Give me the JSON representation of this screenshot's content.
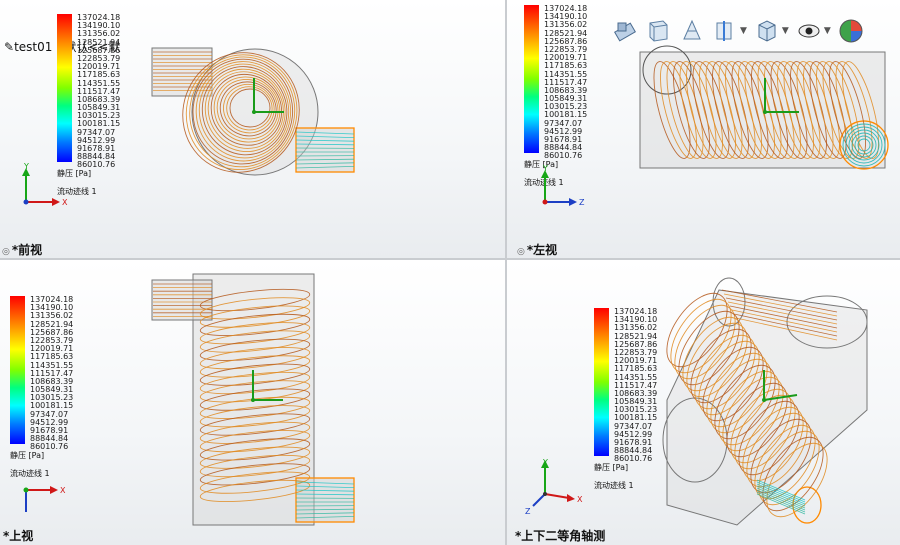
{
  "document": {
    "title": "test01（默认<<默"
  },
  "legend": {
    "values": [
      "137024.18",
      "134190.10",
      "131356.02",
      "128521.94",
      "125687.86",
      "122853.79",
      "120019.71",
      "117185.63",
      "114351.55",
      "111517.47",
      "108683.39",
      "105849.31",
      "103015.23",
      "100181.15",
      "97347.07",
      "94512.99",
      "91678.91",
      "88844.84",
      "86010.76"
    ],
    "unit": "静压 [Pa]",
    "trajectory_label": "流动迹线 1"
  },
  "viewports": {
    "front": {
      "label": "*前视"
    },
    "left": {
      "label": "*左视"
    },
    "top": {
      "label": "*上视"
    },
    "iso": {
      "label": "*上下二等角轴测"
    }
  },
  "axes": {
    "x": "X",
    "y": "Y",
    "z": "Z"
  },
  "toolbar": {
    "items": [
      {
        "name": "section-view-icon"
      },
      {
        "name": "view-orientation-icon"
      },
      {
        "name": "display-style-icon"
      },
      {
        "name": "hide-show-icon"
      },
      {
        "name": "edit-appearance-icon"
      },
      {
        "name": "view-settings-icon"
      },
      {
        "name": "render-tools-icon"
      }
    ]
  },
  "colors": {
    "streamline": "#e08a1e",
    "streamline_dark": "#b4571a",
    "divider": "#c9ccd0"
  }
}
